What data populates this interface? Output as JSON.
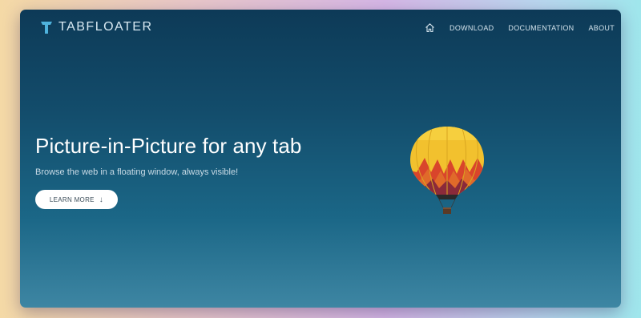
{
  "brand": {
    "name": "TABFLOATER",
    "icon": "t-logo-icon",
    "color": "#4fb3dd"
  },
  "nav": {
    "home_icon": "home-icon",
    "links": [
      "DOWNLOAD",
      "DOCUMENTATION",
      "ABOUT"
    ]
  },
  "hero": {
    "title": "Picture-in-Picture for any tab",
    "subtitle": "Browse the web in a floating window, always visible!",
    "cta_label": "LEARN MORE",
    "cta_icon": "arrow-down-icon",
    "image": "hot-air-balloon"
  },
  "colors": {
    "bg_top": "#0d3a57",
    "bg_bottom": "#3e86a3",
    "balloon_yellow": "#f2c12e",
    "balloon_red": "#d9452b"
  }
}
